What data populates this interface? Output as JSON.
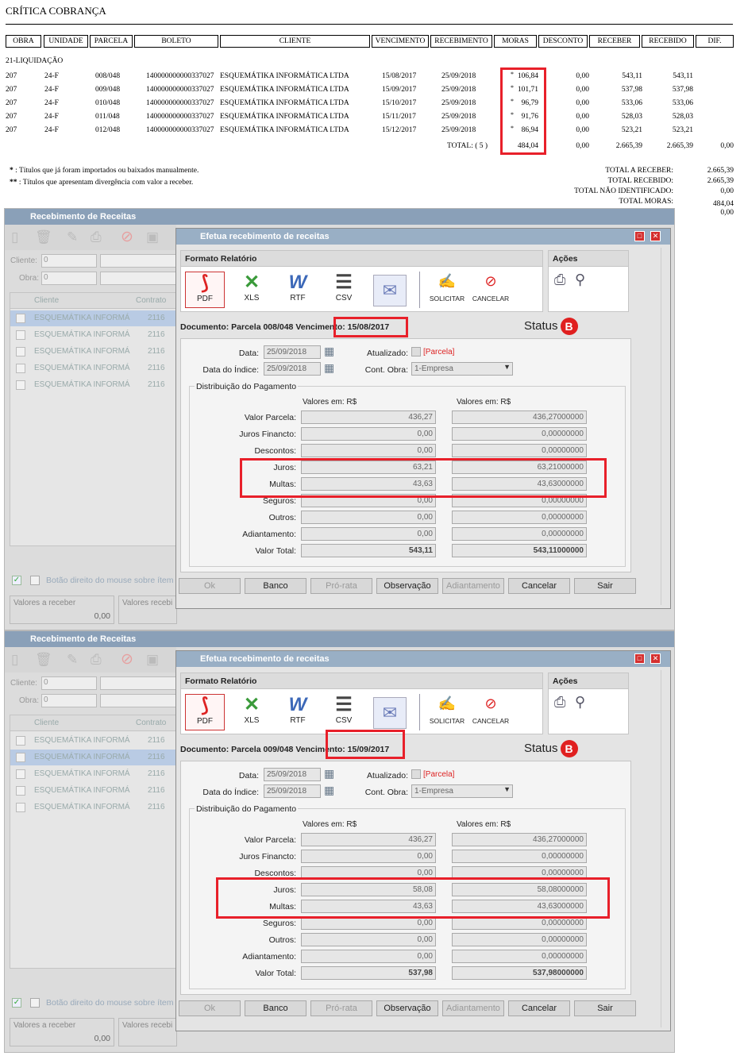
{
  "report": {
    "title": "CRÍTICA COBRANÇA",
    "columns": [
      "OBRA",
      "UNIDADE",
      "PARCELA",
      "BOLETO",
      "CLIENTE",
      "VENCIMENTO",
      "RECEBIMENTO",
      "MORAS",
      "DESCONTO",
      "RECEBER",
      "RECEBIDO",
      "DIF."
    ],
    "group": "21-LIQUIDAÇÃO",
    "rows": [
      {
        "obra": "207",
        "unidade": "24-F",
        "parcela": "008/048",
        "boleto": "140000000000337027",
        "cliente": "ESQUEMÁTIKA INFORMÁTICA LTDA",
        "vencimento": "15/08/2017",
        "recebimento": "25/09/2018",
        "moras": "106,84",
        "desconto": "0,00",
        "receber": "543,11",
        "recebido": "543,11"
      },
      {
        "obra": "207",
        "unidade": "24-F",
        "parcela": "009/048",
        "boleto": "140000000000337027",
        "cliente": "ESQUEMÁTIKA INFORMÁTICA LTDA",
        "vencimento": "15/09/2017",
        "recebimento": "25/09/2018",
        "moras": "101,71",
        "desconto": "0,00",
        "receber": "537,98",
        "recebido": "537,98"
      },
      {
        "obra": "207",
        "unidade": "24-F",
        "parcela": "010/048",
        "boleto": "140000000000337027",
        "cliente": "ESQUEMÁTIKA INFORMÁTICA LTDA",
        "vencimento": "15/10/2017",
        "recebimento": "25/09/2018",
        "moras": "96,79",
        "desconto": "0,00",
        "receber": "533,06",
        "recebido": "533,06"
      },
      {
        "obra": "207",
        "unidade": "24-F",
        "parcela": "011/048",
        "boleto": "140000000000337027",
        "cliente": "ESQUEMÁTIKA INFORMÁTICA LTDA",
        "vencimento": "15/11/2017",
        "recebimento": "25/09/2018",
        "moras": "91,76",
        "desconto": "0,00",
        "receber": "528,03",
        "recebido": "528,03"
      },
      {
        "obra": "207",
        "unidade": "24-F",
        "parcela": "012/048",
        "boleto": "140000000000337027",
        "cliente": "ESQUEMÁTIKA INFORMÁTICA LTDA",
        "vencimento": "15/12/2017",
        "recebimento": "25/09/2018",
        "moras": "86,94",
        "desconto": "0,00",
        "receber": "523,21",
        "recebido": "523,21"
      }
    ],
    "row_marker": "*",
    "total": {
      "label": "TOTAL:",
      "count": "( 5 )",
      "moras": "484,04",
      "desconto": "0,00",
      "receber": "2.665,39",
      "recebido": "2.665,39",
      "dif": "0,00"
    },
    "notes": [
      {
        "mark": "*",
        "text": ": Títulos que já foram importados ou baixados manualmente."
      },
      {
        "mark": "**",
        "text": ": Títulos que apresentam divergência com valor a receber."
      }
    ],
    "summary": [
      {
        "label": "TOTAL A RECEBER:",
        "value": "2.665,39"
      },
      {
        "label": "TOTAL RECEBIDO:",
        "value": "2.665,39"
      },
      {
        "label": "TOTAL NÃO IDENTIFICADO:",
        "value": "0,00"
      },
      {
        "label": "TOTAL MORAS:",
        "value": "484,04"
      }
    ],
    "summary_extra": "0,00"
  },
  "app": {
    "bg_title": "Recebimento de Receitas",
    "dialog_title": "Efetua recebimento de receitas",
    "cliente_label": "Cliente:",
    "obra_label": "Obra:",
    "bg_input_value": "0",
    "col_cliente": "Cliente",
    "col_contrato": "Contrato",
    "bg_row_name": "ESQUEMÁTIKA INFORMÁ",
    "bg_row_contract": "2116",
    "bottom_hint": "Botão direito do mouse sobre ítem",
    "valores_receber": "Valores a receber",
    "valores_receber_value": "0,00",
    "valores_recebidos": "Valores recebi",
    "formato_label": "Formato Relatório",
    "acoes_label": "Ações",
    "formats": [
      "PDF",
      "XLS",
      "RTF",
      "CSV"
    ],
    "solicitar": "SOLICITAR",
    "cancelar_label": "CANCELAR",
    "status_label": "Status",
    "status_badge": "B",
    "data_label": "Data:",
    "data_indice_label": "Data do Índice:",
    "atualizado_label": "Atualizado:",
    "parcela_tag": "[Parcela]",
    "cont_obra_label": "Cont. Obra:",
    "cont_obra_value": "1-Empresa",
    "distrib_label": "Distribuição do Pagamento",
    "valores_em": "Valores em: R$",
    "field_labels": [
      "Valor Parcela:",
      "Juros Financto:",
      "Descontos:",
      "Juros:",
      "Multas:",
      "Seguros:",
      "Outros:",
      "Adiantamento:",
      "Valor Total:"
    ],
    "buttons": [
      "Ok",
      "Banco",
      "Pró-rata",
      "Observação",
      "Adiantamento",
      "Cancelar",
      "Sair"
    ]
  },
  "dialogs": [
    {
      "documento": "Documento: Parcela 008/048 Vencimento: 15/08/2017",
      "data": "25/09/2018",
      "data_indice": "25/09/2018",
      "values_a": [
        "436,27",
        "0,00",
        "0,00",
        "63,21",
        "43,63",
        "0,00",
        "0,00",
        "0,00",
        "543,11"
      ],
      "values_b": [
        "436,27000000",
        "0,00000000",
        "0,00000000",
        "63,21000000",
        "43,63000000",
        "0,00000000",
        "0,00000000",
        "0,00000000",
        "543,11000000"
      ]
    },
    {
      "documento": "Documento: Parcela 009/048 Vencimento: 15/09/2017",
      "data": "25/09/2018",
      "data_indice": "25/09/2018",
      "values_a": [
        "436,27",
        "0,00",
        "0,00",
        "58,08",
        "43,63",
        "0,00",
        "0,00",
        "0,00",
        "537,98"
      ],
      "values_b": [
        "436,27000000",
        "0,00000000",
        "0,00000000",
        "58,08000000",
        "43,63000000",
        "0,00000000",
        "0,00000000",
        "0,00000000",
        "537,98000000"
      ]
    }
  ],
  "colors": {
    "highlight": "#e8202a",
    "accent": "#99afc5"
  }
}
